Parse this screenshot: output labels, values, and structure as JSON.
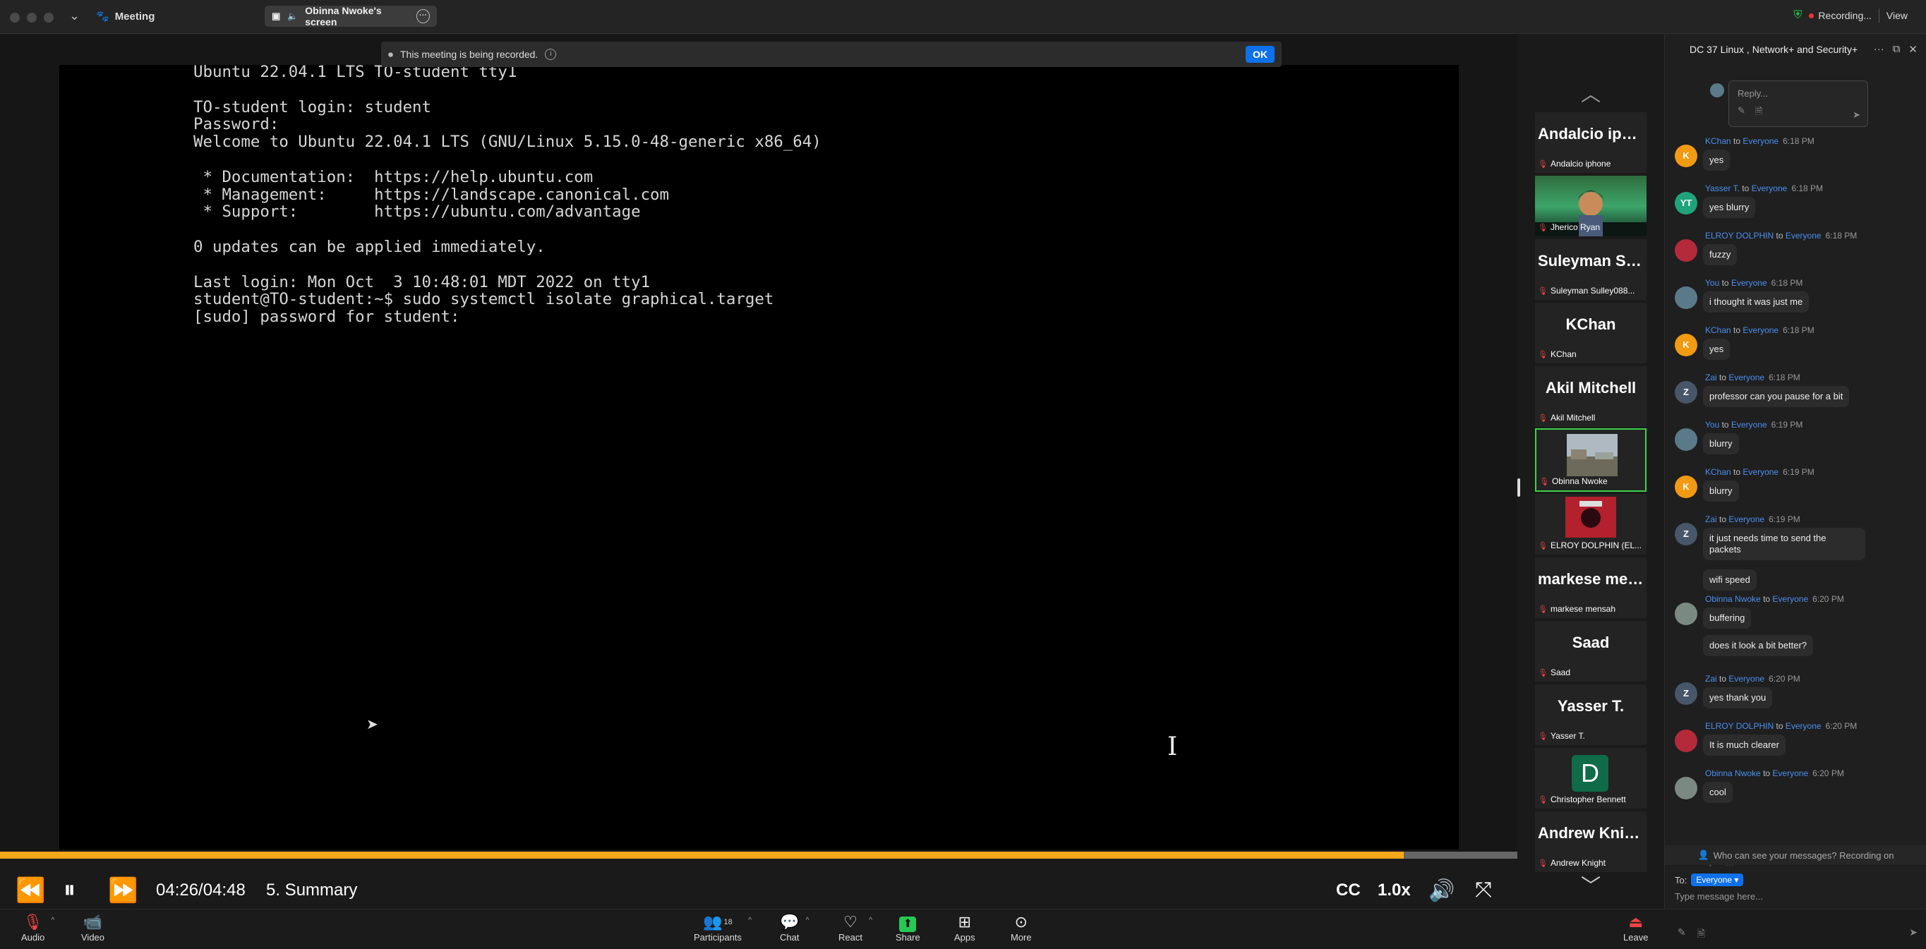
{
  "titlebar": {
    "meeting_label": "Meeting",
    "share_label": "Obinna Nwoke's screen",
    "recording_label": "Recording...",
    "view_label": "View"
  },
  "banner": {
    "text": "This meeting is being recorded.",
    "ok_label": "OK"
  },
  "terminal": {
    "lines": "Ubuntu 22.04.1 LTS TO-student tty1\n\nTO-student login: student\nPassword:\nWelcome to Ubuntu 22.04.1 LTS (GNU/Linux 5.15.0-48-generic x86_64)\n\n * Documentation:  https://help.ubuntu.com\n * Management:     https://landscape.canonical.com\n * Support:        https://ubuntu.com/advantage\n\n0 updates can be applied immediately.\n\nLast login: Mon Oct  3 10:48:01 MDT 2022 on tty1\nstudent@TO-student:~$ sudo systemctl isolate graphical.target\n[sudo] password for student:"
  },
  "playback": {
    "progress_fraction": 0.925,
    "time": "04:26/04:48",
    "chapter": "5. Summary",
    "cc_label": "CC",
    "speed_label": "1.0x"
  },
  "toolbar": {
    "audio": "Audio",
    "video": "Video",
    "participants": "Participants",
    "participants_count": "18",
    "chat": "Chat",
    "react": "React",
    "share": "Share",
    "apps": "Apps",
    "more": "More",
    "leave": "Leave"
  },
  "participants": [
    {
      "big": "Andalcio ipho...",
      "small": "Andalcio iphone"
    },
    {
      "big": "",
      "small": "Jherico Ryan"
    },
    {
      "big": "Suleyman Sul...",
      "small": "Suleyman Sulley088..."
    },
    {
      "big": "KChan",
      "small": "KChan"
    },
    {
      "big": "Akil Mitchell",
      "small": "Akil Mitchell"
    },
    {
      "big": "",
      "small": "Obinna Nwoke"
    },
    {
      "big": "",
      "small": "ELROY DOLPHIN (EL..."
    },
    {
      "big": "markese men...",
      "small": "markese mensah"
    },
    {
      "big": "Saad",
      "small": "Saad"
    },
    {
      "big": "Yasser T.",
      "small": "Yasser T."
    },
    {
      "big": "D",
      "small": "Christopher Bennett"
    },
    {
      "big": "Andrew Knight",
      "small": "Andrew Knight"
    }
  ],
  "chat": {
    "title": "DC 37 Linux , Network+ and Security+",
    "reply_placeholder": "Reply...",
    "to_word": "to",
    "messages": [
      {
        "initials": "K",
        "color": "#f29a12",
        "sender": "KChan",
        "recipient": "Everyone",
        "time": "6:18 PM",
        "bubbles": [
          "yes"
        ]
      },
      {
        "initials": "YT",
        "color": "#1fa37a",
        "sender": "Yasser T.",
        "recipient": "Everyone",
        "time": "6:18 PM",
        "bubbles": [
          "yes blurry"
        ]
      },
      {
        "initials": "",
        "color": "#b52a3a",
        "sender": "ELROY DOLPHIN",
        "recipient": "Everyone",
        "time": "6:18 PM",
        "bubbles": [
          "fuzzy"
        ]
      },
      {
        "initials": "",
        "color": "#5a7a8a",
        "sender": "You",
        "recipient": "Everyone",
        "time": "6:18 PM",
        "bubbles": [
          "i thought it was just me"
        ]
      },
      {
        "initials": "K",
        "color": "#f29a12",
        "sender": "KChan",
        "recipient": "Everyone",
        "time": "6:18 PM",
        "bubbles": [
          "yes"
        ]
      },
      {
        "initials": "Z",
        "color": "#48566a",
        "sender": "Zai",
        "recipient": "Everyone",
        "time": "6:18 PM",
        "bubbles": [
          "professor can you pause for a bit"
        ]
      },
      {
        "initials": "",
        "color": "#5a7a8a",
        "sender": "You",
        "recipient": "Everyone",
        "time": "6:19 PM",
        "bubbles": [
          "blurry"
        ]
      },
      {
        "initials": "K",
        "color": "#f29a12",
        "sender": "KChan",
        "recipient": "Everyone",
        "time": "6:19 PM",
        "bubbles": [
          "blurry"
        ]
      },
      {
        "initials": "Z",
        "color": "#48566a",
        "sender": "Zai",
        "recipient": "Everyone",
        "time": "6:19 PM",
        "bubbles": [
          "it just needs time to send the packets",
          "wifi speed"
        ]
      },
      {
        "initials": "",
        "color": "#7a8a82",
        "sender": "Obinna Nwoke",
        "recipient": "Everyone",
        "time": "6:20 PM",
        "bubbles": [
          "buffering",
          "does it look a bit better?"
        ]
      },
      {
        "initials": "Z",
        "color": "#48566a",
        "sender": "Zai",
        "recipient": "Everyone",
        "time": "6:20 PM",
        "bubbles": [
          "yes thank you"
        ]
      },
      {
        "initials": "",
        "color": "#b52a3a",
        "sender": "ELROY DOLPHIN",
        "recipient": "Everyone",
        "time": "6:20 PM",
        "bubbles": [
          "It is much clearer"
        ]
      },
      {
        "initials": "",
        "color": "#7a8a82",
        "sender": "Obinna Nwoke",
        "recipient": "Everyone",
        "time": "6:20 PM",
        "bubbles": [
          "cool"
        ]
      }
    ],
    "privacy_text": "Who can see your messages? Recording on",
    "to_label": "To:",
    "to_value": "Everyone",
    "input_placeholder": "Type message here..."
  },
  "colors": {
    "accent_blue": "#0e71eb",
    "progress_orange": "#f7a81b",
    "active_tile_green": "#3ad34a",
    "share_green": "#26c952",
    "record_red": "#e33"
  }
}
